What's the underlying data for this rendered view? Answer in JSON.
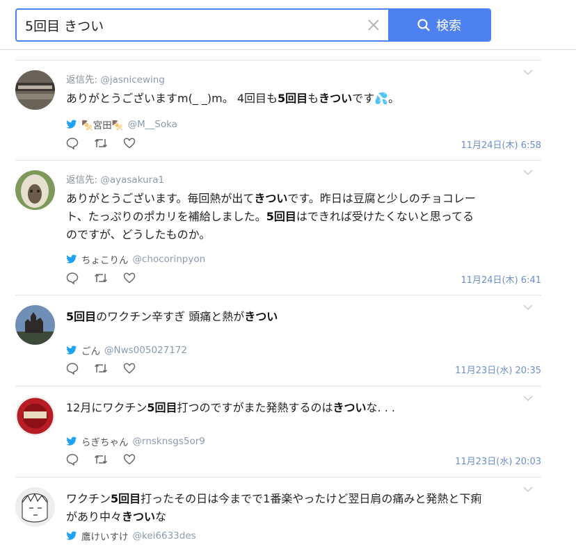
{
  "search": {
    "value": "5回目 きつい",
    "button_label": "検索"
  },
  "colors": {
    "accent": "#4e81f0",
    "link": "#8a9bb0",
    "time": "#6b8fc9",
    "twitter": "#1da1f2"
  },
  "tweets": [
    {
      "reply_prefix": "返信先:",
      "reply_to": "@jasnicewing",
      "text_parts": [
        {
          "t": "ありがとうございますm(_ _)m。 4回目も",
          "b": false
        },
        {
          "t": "5回目",
          "b": true
        },
        {
          "t": "も",
          "b": false
        },
        {
          "t": "きつい",
          "b": true
        },
        {
          "t": "です",
          "b": false
        },
        {
          "t": "💦",
          "b": false
        },
        {
          "t": "。",
          "b": false
        }
      ],
      "author_name": "🍢宮田🍢",
      "author_handle": "@M__Soka",
      "time": "11月24日(木) 6:58"
    },
    {
      "reply_prefix": "返信先:",
      "reply_to": "@ayasakura1",
      "text_parts": [
        {
          "t": "ありがとうございます。毎回熱が出て",
          "b": false
        },
        {
          "t": "きつい",
          "b": true
        },
        {
          "t": "です。昨日は豆腐と少しのチョコレー",
          "b": false
        },
        {
          "t": "ト、たっぷりのポカリを補給しました。",
          "b": false
        },
        {
          "t": "5回目",
          "b": true
        },
        {
          "t": "はできれば受けたくないと思ってる",
          "b": false
        },
        {
          "t": "のですが、どうしたものか。",
          "b": false
        }
      ],
      "author_name": "ちょこりん",
      "author_handle": "@chocorinpyon",
      "time": "11月24日(木) 6:41"
    },
    {
      "text_parts": [
        {
          "t": "5回目",
          "b": true
        },
        {
          "t": "のワクチン辛すぎ 頭痛と熱が",
          "b": false
        },
        {
          "t": "きつい",
          "b": true
        }
      ],
      "author_name": "ごん",
      "author_handle": "@Nws005027172",
      "time": "11月23日(水) 20:35"
    },
    {
      "text_parts": [
        {
          "t": "12月にワクチン",
          "b": false
        },
        {
          "t": "5回目",
          "b": true
        },
        {
          "t": "打つのですがまた発熱するのは",
          "b": false
        },
        {
          "t": "きつい",
          "b": true
        },
        {
          "t": "な. . .",
          "b": false
        }
      ],
      "author_name": "らぎちゃん",
      "author_handle": "@rnsknsgs5or9",
      "time": "11月23日(水) 20:03"
    },
    {
      "text_parts": [
        {
          "t": "ワクチン",
          "b": false
        },
        {
          "t": "5回目",
          "b": true
        },
        {
          "t": "打ったその日は今までで1番楽やったけど翌日肩の痛みと発熱と下痢",
          "b": false
        },
        {
          "t": "があり中々",
          "b": false
        },
        {
          "t": "きつい",
          "b": true
        },
        {
          "t": "な",
          "b": false
        }
      ],
      "author_name": "鷹けいすけ",
      "author_handle": "@kei6633des",
      "time": ""
    }
  ]
}
